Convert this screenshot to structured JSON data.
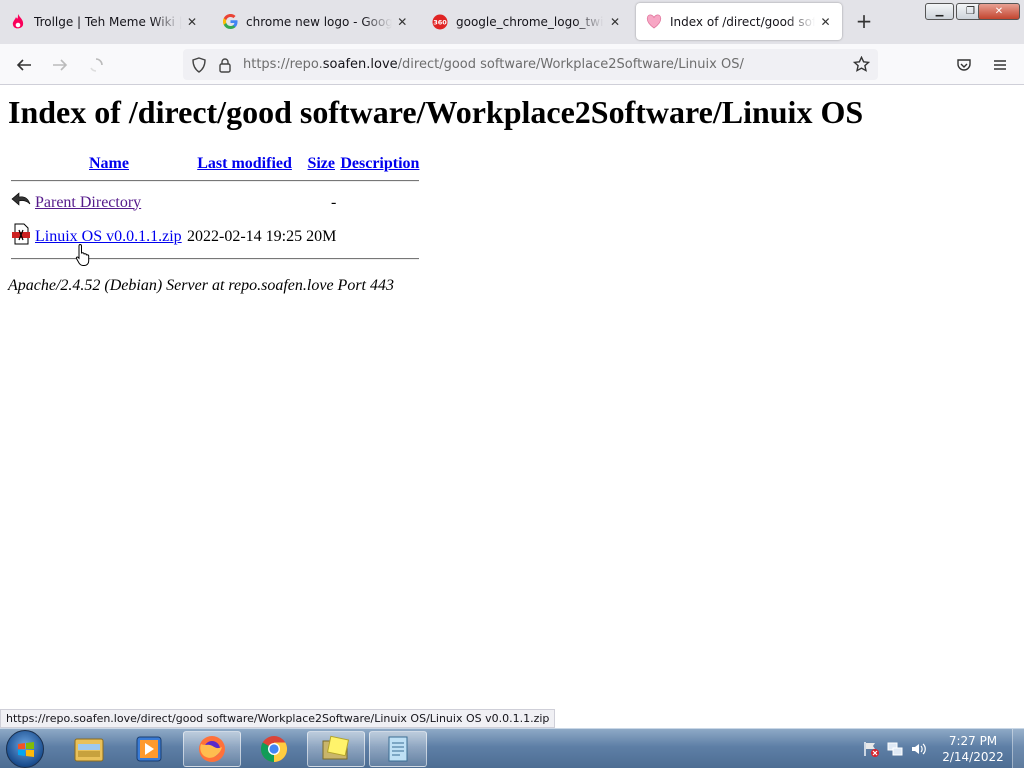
{
  "browser": {
    "tabs": [
      {
        "title": "Trollge | Teh Meme Wiki | Fandom",
        "favicon": "fandom-flame-icon"
      },
      {
        "title": "chrome new logo - Google Search",
        "favicon": "google-g-icon"
      },
      {
        "title": "google_chrome_logo_twitter",
        "favicon": "360-icon"
      },
      {
        "title": "Index of /direct/good software",
        "favicon": "pink-heart-icon",
        "active": true
      }
    ],
    "url": {
      "prefix": "https://repo.",
      "domain": "soafen.love",
      "path": "/direct/good software/Workplace2Software/Linuix OS/"
    },
    "status_url": "https://repo.soafen.love/direct/good software/Workplace2Software/Linuix OS/Linuix OS v0.0.1.1.zip"
  },
  "page": {
    "heading": "Index of /direct/good software/Workplace2Software/Linuix OS",
    "columns": {
      "name": "Name",
      "modified": "Last modified",
      "size": "Size",
      "description": "Description"
    },
    "rows": [
      {
        "name": "Parent Directory",
        "modified": "",
        "size": "-",
        "description": "",
        "icon": "back-arrow-icon"
      },
      {
        "name": "Linuix OS v0.0.1.1.zip",
        "modified": "2022-02-14 19:25",
        "size": "20M",
        "description": "",
        "icon": "compressed-file-icon"
      }
    ],
    "address": "Apache/2.4.52 (Debian) Server at repo.soafen.love Port 443"
  },
  "taskbar": {
    "items": [
      "explorer-icon",
      "media-player-icon",
      "firefox-icon",
      "chrome-icon",
      "folder-notes-icon",
      "notepad-icon"
    ],
    "time": "7:27 PM",
    "date": "2/14/2022"
  }
}
